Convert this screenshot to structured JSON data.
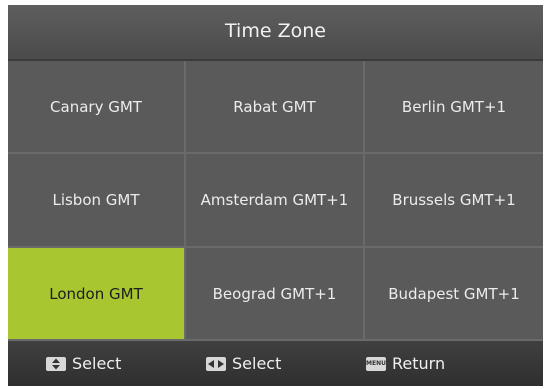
{
  "header": {
    "title": "Time Zone"
  },
  "zones": [
    {
      "label": "Canary GMT",
      "selected": false
    },
    {
      "label": "Rabat GMT",
      "selected": false
    },
    {
      "label": "Berlin GMT+1",
      "selected": false
    },
    {
      "label": "Lisbon GMT",
      "selected": false
    },
    {
      "label": "Amsterdam GMT+1",
      "selected": false
    },
    {
      "label": "Brussels GMT+1",
      "selected": false
    },
    {
      "label": "London GMT",
      "selected": true
    },
    {
      "label": "Beograd GMT+1",
      "selected": false
    },
    {
      "label": "Budapest GMT+1",
      "selected": false
    }
  ],
  "footer": {
    "updown_label": "Select",
    "leftright_label": "Select",
    "menu_key_text": "MENU",
    "return_label": "Return"
  },
  "colors": {
    "selected": "#a8c630",
    "cell": "#5a5a5a",
    "background": "#4a4a4a"
  },
  "icons": [
    "up-down-arrow-icon",
    "left-right-arrow-icon",
    "menu-key-icon"
  ]
}
